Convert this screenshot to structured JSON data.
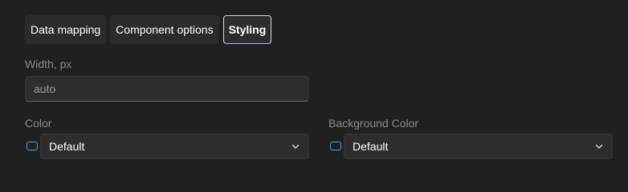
{
  "tabs": [
    {
      "label": "Data mapping",
      "selected": false
    },
    {
      "label": "Component options",
      "selected": false
    },
    {
      "label": "Styling",
      "selected": true
    }
  ],
  "width_field": {
    "label": "Width, px",
    "value": "auto"
  },
  "color_field": {
    "label": "Color",
    "value": "Default",
    "swatch_icon": "color-swatch-icon",
    "dropdown_icon": "chevron-down-icon"
  },
  "background_color_field": {
    "label": "Background Color",
    "value": "Default",
    "swatch_icon": "color-swatch-icon",
    "dropdown_icon": "chevron-down-icon"
  },
  "colors": {
    "background": "#202020",
    "control": "#2d2d2d",
    "swatch_border": "#4fa0e0",
    "label": "#8a8a8a"
  }
}
